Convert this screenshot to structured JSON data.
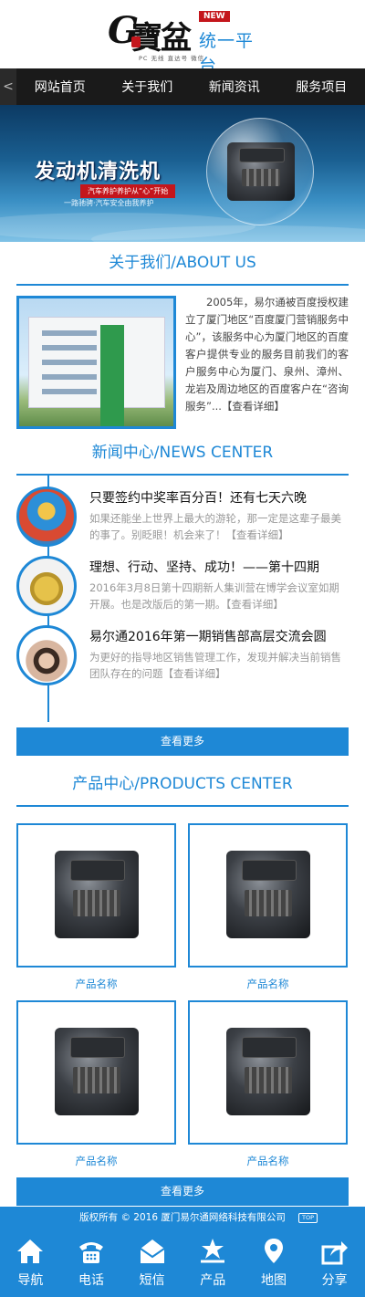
{
  "logo": {
    "mark": "G",
    "chinese": "寶盆",
    "badge": "NEW",
    "platform": "统一平台",
    "subtitle": "PC 无线 直达号 微信"
  },
  "nav": {
    "prev_arrow": "<",
    "items": [
      "网站首页",
      "关于我们",
      "新闻资讯",
      "服务项目"
    ]
  },
  "banner": {
    "title": "发动机清洗机",
    "tag": "汽车养护养护从“心”开始",
    "subtitle": "一路驰骋·汽车安全由我养护"
  },
  "about": {
    "title": "关于我们/ABOUT US",
    "text": "2005年，易尔通被百度授权建立了厦门地区“百度厦门营销服务中心”，该服务中心为厦门地区的百度客户提供专业的服务目前我们的客户服务中心为厦门、泉州、漳州、龙岩及周边地区的百度客户在“咨询服务”...【查看详细】"
  },
  "news": {
    "title": "新闻中心/NEWS CENTER",
    "items": [
      {
        "title": "只要签约中奖率百分百！还有七天六晚",
        "desc": "如果还能坐上世界上最大的游轮，那一定是这辈子最美的事了。别眨眼！机会来了！【查看详细】"
      },
      {
        "title": "理想、行动、坚持、成功！——第十四期",
        "desc": "2016年3月8日第十四期新人集训营在博学会议室如期开展。也是改版后的第一期。【查看详细】"
      },
      {
        "title": "易尔通2016年第一期销售部高层交流会圆",
        "desc": "为更好的指导地区销售管理工作，发现并解决当前销售团队存在的问题【查看详细】"
      }
    ],
    "more": "查看更多"
  },
  "products": {
    "title": "产品中心/PRODUCTS CENTER",
    "items": [
      {
        "name": "产品名称"
      },
      {
        "name": "产品名称"
      },
      {
        "name": "产品名称"
      },
      {
        "name": "产品名称"
      }
    ],
    "more": "查看更多"
  },
  "footer": {
    "copyright": "版权所有 © 2016 厦门易尔通网络科技有限公司",
    "top": "TOP"
  },
  "bottombar": [
    {
      "label": "导航",
      "icon": "home-icon"
    },
    {
      "label": "电话",
      "icon": "phone-icon"
    },
    {
      "label": "短信",
      "icon": "message-icon"
    },
    {
      "label": "产品",
      "icon": "products-icon"
    },
    {
      "label": "地图",
      "icon": "map-pin-icon"
    },
    {
      "label": "分享",
      "icon": "share-icon"
    }
  ],
  "colors": {
    "accent": "#1e88d6",
    "nav_bg": "#1a1a1a",
    "badge": "#c4161c"
  }
}
